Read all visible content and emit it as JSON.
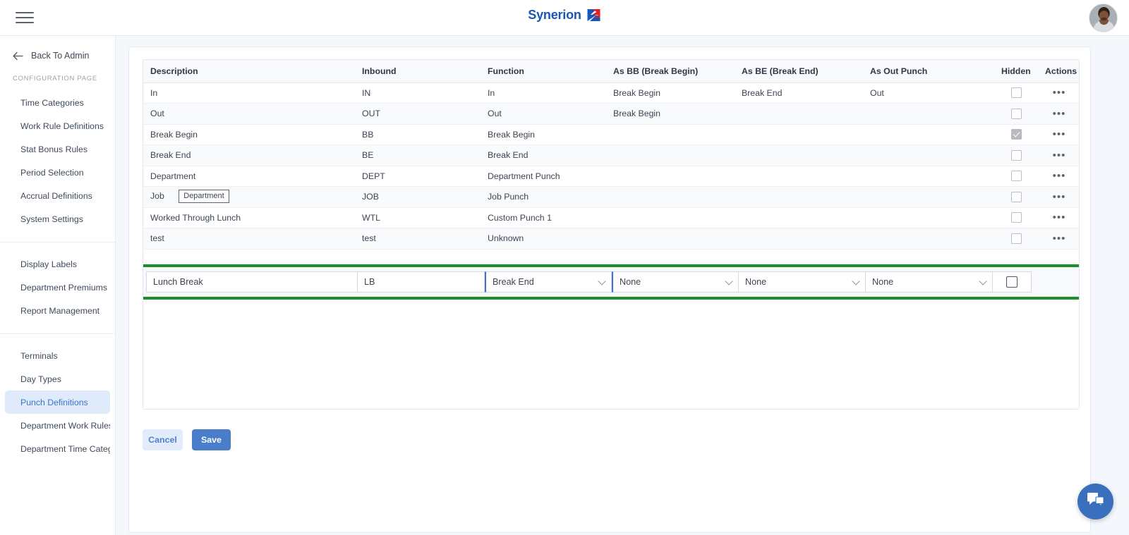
{
  "header": {
    "menu_icon": "hamburger-icon",
    "brand_name": "Synerion",
    "brand_mark_icon": "synerion-logo-mark",
    "avatar_icon": "user-avatar"
  },
  "sidebar": {
    "back_label": "Back To Admin",
    "back_icon": "arrow-left-icon",
    "section_label": "CONFIGURATION PAGE",
    "group1": [
      {
        "label": "Time Categories",
        "active": false
      },
      {
        "label": "Work Rule Definitions",
        "active": false
      },
      {
        "label": "Stat Bonus Rules",
        "active": false
      },
      {
        "label": "Period Selection",
        "active": false
      },
      {
        "label": "Accrual Definitions",
        "active": false
      },
      {
        "label": "System Settings",
        "active": false
      }
    ],
    "group2": [
      {
        "label": "Display Labels",
        "active": false
      },
      {
        "label": "Department Premiums",
        "active": false
      },
      {
        "label": "Report Management",
        "active": false
      }
    ],
    "group3": [
      {
        "label": "Terminals",
        "active": false
      },
      {
        "label": "Day Types",
        "active": false
      },
      {
        "label": "Punch Definitions",
        "active": true
      },
      {
        "label": "Department Work Rules Filt...",
        "active": false
      },
      {
        "label": "Department Time Category ...",
        "active": false
      }
    ]
  },
  "table": {
    "columns": [
      "Description",
      "Inbound",
      "Function",
      "As BB (Break Begin)",
      "As BE (Break End)",
      "As Out Punch",
      "Hidden",
      "Actions"
    ],
    "rows": [
      {
        "description": "In",
        "inbound": "IN",
        "function": "In",
        "as_bb": "Break Begin",
        "as_be": "Break End",
        "as_out": "Out",
        "hidden": false,
        "tooltip": ""
      },
      {
        "description": "Out",
        "inbound": "OUT",
        "function": "Out",
        "as_bb": "Break Begin",
        "as_be": "",
        "as_out": "",
        "hidden": false,
        "tooltip": ""
      },
      {
        "description": "Break Begin",
        "inbound": "BB",
        "function": "Break Begin",
        "as_bb": "",
        "as_be": "",
        "as_out": "",
        "hidden": true,
        "tooltip": ""
      },
      {
        "description": "Break End",
        "inbound": "BE",
        "function": "Break End",
        "as_bb": "",
        "as_be": "",
        "as_out": "",
        "hidden": false,
        "tooltip": ""
      },
      {
        "description": "Department",
        "inbound": "DEPT",
        "function": "Department Punch",
        "as_bb": "",
        "as_be": "",
        "as_out": "",
        "hidden": false,
        "tooltip": ""
      },
      {
        "description": "Job",
        "inbound": "JOB",
        "function": "Job Punch",
        "as_bb": "",
        "as_be": "",
        "as_out": "",
        "hidden": false,
        "tooltip": "Department"
      },
      {
        "description": "Worked Through Lunch",
        "inbound": "WTL",
        "function": "Custom Punch 1",
        "as_bb": "",
        "as_be": "",
        "as_out": "",
        "hidden": false,
        "tooltip": ""
      },
      {
        "description": "test",
        "inbound": "test",
        "function": "Unknown",
        "as_bb": "",
        "as_be": "",
        "as_out": "",
        "hidden": false,
        "tooltip": ""
      }
    ],
    "actions_icon": "ellipsis-icon"
  },
  "edit_row": {
    "highlight_color": "#1a9027",
    "description_value": "Lunch Break",
    "description_placeholder": "Description",
    "inbound_value": "LB",
    "inbound_placeholder": "Inbound",
    "function_value": "Break End",
    "as_bb_value": "None",
    "as_be_value": "None",
    "as_out_value": "None",
    "hidden_checked": false,
    "chevron_icon": "chevron-down-icon"
  },
  "footer": {
    "cancel_label": "Cancel",
    "save_label": "Save",
    "cancel_color": "#4f7fd0",
    "save_color": "#4a7ecb"
  },
  "chat": {
    "icon": "chat-bubble-icon",
    "color": "#3a6fbd"
  }
}
